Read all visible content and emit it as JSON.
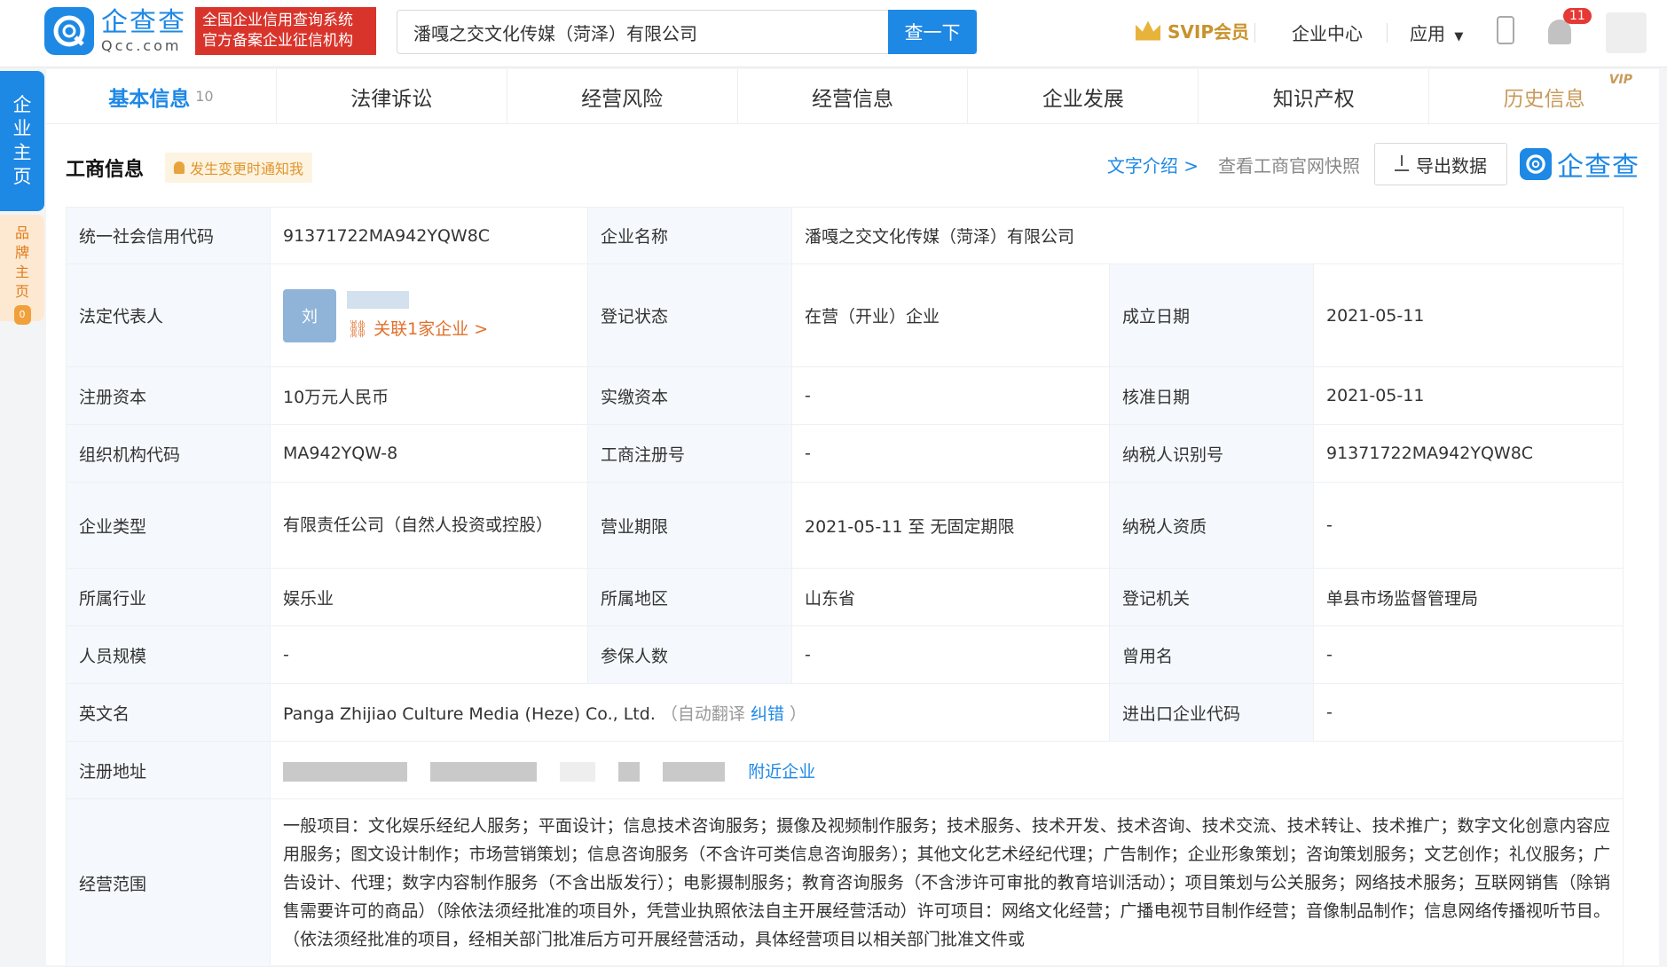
{
  "header": {
    "logo_cn": "企查查",
    "logo_en": "Qcc.com",
    "banner_line1": "全国企业信用查询系统",
    "banner_line2": "官方备案企业征信机构",
    "search_value": "潘嘎之交文化传媒（菏泽）有限公司",
    "search_button": "查一下",
    "svip_label": "SVIP会员",
    "enterprise_center": "企业中心",
    "apps": "应用",
    "notification_count": "11"
  },
  "side": {
    "main_label": [
      "企",
      "业",
      "主",
      "页"
    ],
    "brand_label": [
      "品",
      "牌",
      "主",
      "页"
    ],
    "brand_count": "0"
  },
  "tabs": [
    {
      "label": "基本信息",
      "count": "10"
    },
    {
      "label": "法律诉讼"
    },
    {
      "label": "经营风险"
    },
    {
      "label": "经营信息"
    },
    {
      "label": "企业发展"
    },
    {
      "label": "知识产权"
    },
    {
      "label": "历史信息",
      "tag": "VIP"
    }
  ],
  "section": {
    "title": "工商信息",
    "notify": "发生变更时通知我",
    "text_intro": "文字介绍 >",
    "snapshot": "查看工商官网快照",
    "export": "导出数据",
    "brand": "企查查"
  },
  "info": {
    "credit_code_label": "统一社会信用代码",
    "credit_code": "91371722MA942YQW8C",
    "company_name_label": "企业名称",
    "company_name": "潘嘎之交文化传媒（菏泽）有限公司",
    "legal_rep_label": "法定代表人",
    "legal_rep_avatar": "刘",
    "legal_rep_link": "关联1家企业 >",
    "reg_status_label": "登记状态",
    "reg_status": "在营（开业）企业",
    "est_date_label": "成立日期",
    "est_date": "2021-05-11",
    "reg_capital_label": "注册资本",
    "reg_capital": "10万元人民币",
    "paid_capital_label": "实缴资本",
    "paid_capital": "-",
    "approve_date_label": "核准日期",
    "approve_date": "2021-05-11",
    "org_code_label": "组织机构代码",
    "org_code": "MA942YQW-8",
    "biz_reg_no_label": "工商注册号",
    "biz_reg_no": "-",
    "taxpayer_id_label": "纳税人识别号",
    "taxpayer_id": "91371722MA942YQW8C",
    "company_type_label": "企业类型",
    "company_type": "有限责任公司（自然人投资或控股）",
    "biz_term_label": "营业期限",
    "biz_term": "2021-05-11 至 无固定期限",
    "taxpayer_qual_label": "纳税人资质",
    "taxpayer_qual": "-",
    "industry_label": "所属行业",
    "industry": "娱乐业",
    "region_label": "所属地区",
    "region": "山东省",
    "reg_authority_label": "登记机关",
    "reg_authority": "单县市场监督管理局",
    "staff_size_label": "人员规模",
    "staff_size": "-",
    "insured_label": "参保人数",
    "insured": "-",
    "former_name_label": "曾用名",
    "former_name": "-",
    "english_name_label": "英文名",
    "english_name": "Panga Zhijiao Culture Media (Heze) Co., Ltd.",
    "auto_translate": "（自动翻译",
    "correct": "纠错",
    "close_paren": "）",
    "import_export_label": "进出口企业代码",
    "import_export": "-",
    "address_label": "注册地址",
    "nearby": "附近企业",
    "scope_label": "经营范围",
    "scope": "一般项目：文化娱乐经纪人服务；平面设计；信息技术咨询服务；摄像及视频制作服务；技术服务、技术开发、技术咨询、技术交流、技术转让、技术推广；数字文化创意内容应用服务；图文设计制作；市场营销策划；信息咨询服务（不含许可类信息咨询服务）；其他文化艺术经纪代理；广告制作；企业形象策划；咨询策划服务；文艺创作；礼仪服务；广告设计、代理；数字内容制作服务（不含出版发行）；电影摄制服务；教育咨询服务（不含涉许可审批的教育培训活动）；项目策划与公关服务；网络技术服务；互联网销售（除销售需要许可的商品）（除依法须经批准的项目外，凭营业执照依法自主开展经营活动）许可项目：网络文化经营；广播电视节目制作经营；音像制品制作；信息网络传播视听节目。（依法须经批准的项目，经相关部门批准后方可开展经营活动，具体经营项目以相关部门批准文件或"
  }
}
